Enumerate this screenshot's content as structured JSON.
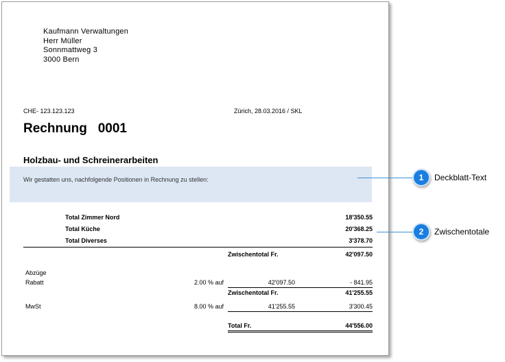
{
  "address": {
    "line1": "Kaufmann Verwaltungen",
    "line2": "Herr Müller",
    "line3": "Sonnmattweg 3",
    "line4": "3000 Bern"
  },
  "vat_number": "CHE- 123.123.123",
  "place_date": "Zürich, 28.03.2016 / SKL",
  "title": "Rechnung   0001",
  "subtitle": "Holzbau- und Schreinerarbeiten",
  "cover_text": "Wir gestatten uns, nachfolgende Positionen in Rechnung zu stellen:",
  "totals": [
    {
      "label": "Total Zimmer Nord",
      "amount": "18'350.55"
    },
    {
      "label": "Total Küche",
      "amount": "20'368.25"
    },
    {
      "label": "Total Diverses",
      "amount": "3'378.70"
    }
  ],
  "subtotal1": {
    "label": "Zwischentotal Fr.",
    "amount": "42'097.50"
  },
  "deductions_heading": "Abzüge",
  "rabatt": {
    "label": "Rabatt",
    "rate": "2.00 % auf",
    "base": "42'097.50",
    "amount": "- 841.95"
  },
  "subtotal2": {
    "label": "Zwischentotal Fr.",
    "amount": "41'255.55"
  },
  "mwst": {
    "label": "MwSt",
    "rate": "8.00 % auf",
    "base": "41'255.55",
    "amount": "3'300.45"
  },
  "grand_total": {
    "label": "Total Fr.",
    "amount": "44'556.00"
  },
  "callouts": [
    {
      "number": "1",
      "label": "Deckblatt-Text"
    },
    {
      "number": "2",
      "label": "Zwischentotale"
    }
  ],
  "colors": {
    "highlight": "#dde7f4",
    "badge": "#1a7ee0",
    "callout_line": "#3d8fd6"
  }
}
